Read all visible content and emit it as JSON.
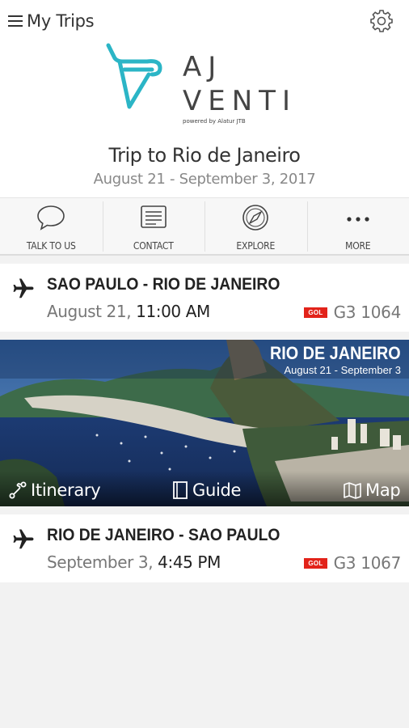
{
  "header": {
    "menu_label": "My Trips",
    "logo_line1": "AJ",
    "logo_line2": "VENTI",
    "logo_tagline": "powered by Alatur JTB",
    "trip_title": "Trip to Rio de Janeiro",
    "trip_dates": "August 21 - September 3, 2017",
    "accent_color": "#2bb5c6"
  },
  "toolbar": [
    {
      "label": "TALK TO US",
      "icon": "speech-bubble-icon"
    },
    {
      "label": "CONTACT",
      "icon": "contact-card-icon"
    },
    {
      "label": "EXPLORE",
      "icon": "compass-icon"
    },
    {
      "label": "MORE",
      "icon": "more-dots-icon"
    }
  ],
  "flights": [
    {
      "route": "SAO PAULO - RIO DE JANEIRO",
      "date": "August 21,",
      "time": "11:00 AM",
      "airline": "GOL",
      "flight_no": "G3 1064"
    },
    {
      "route": "RIO DE JANEIRO - SAO PAULO",
      "date": "September 3,",
      "time": "4:45 PM",
      "airline": "GOL",
      "flight_no": "G3 1067"
    }
  ],
  "destination": {
    "name": "RIO DE JANEIRO",
    "dates": "August 21 - September 3",
    "itinerary_label": "Itinerary",
    "guide_label": "Guide",
    "map_label": "Map"
  }
}
